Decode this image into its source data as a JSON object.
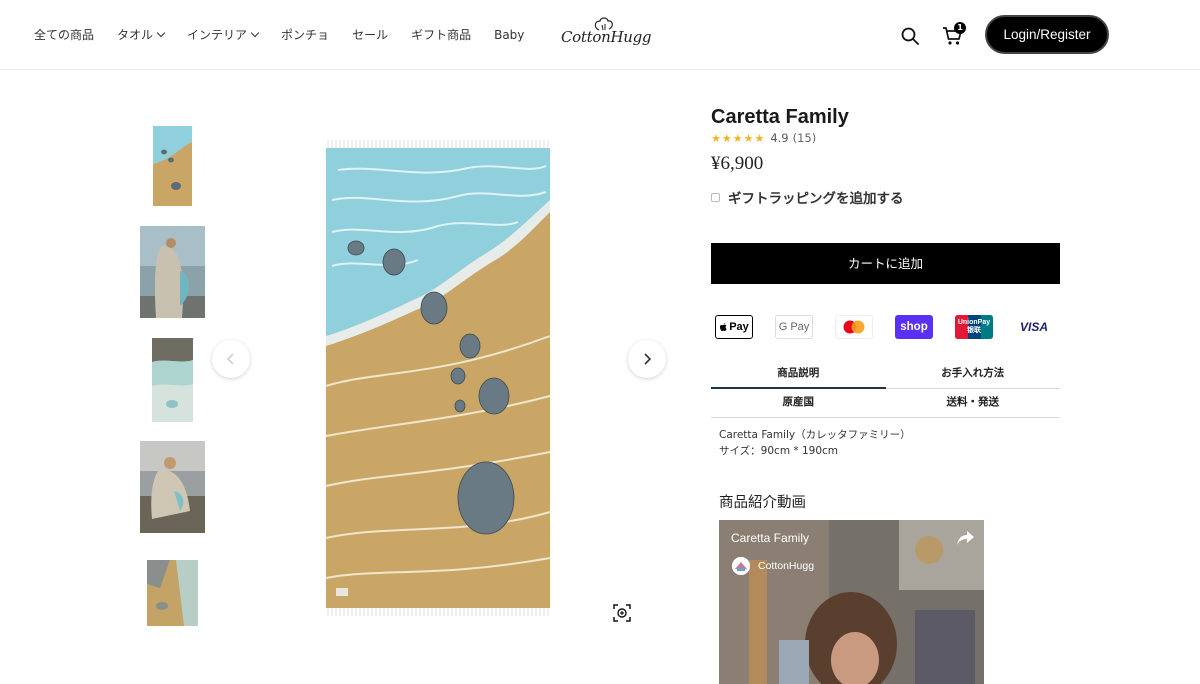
{
  "header": {
    "nav": [
      {
        "label": "全ての商品",
        "dropdown": false
      },
      {
        "label": "タオル",
        "dropdown": true
      },
      {
        "label": "インテリア",
        "dropdown": true
      },
      {
        "label": "ポンチョ",
        "dropdown": false
      },
      {
        "label": "セール",
        "dropdown": false
      },
      {
        "label": "ギフト商品",
        "dropdown": false
      },
      {
        "label": "Baby",
        "dropdown": false
      }
    ],
    "logo_text": "CottonHugg",
    "cart_count": "1",
    "login_label": "Login/Register"
  },
  "product": {
    "title": "Caretta Family",
    "stars": "★★★★★",
    "rating": "4.9",
    "review_count": "(15)",
    "price": "¥6,900",
    "gift_label": "ギフトラッピングを追加する",
    "add_to_cart_label": "カートに追加"
  },
  "payments": {
    "apple": "Pay",
    "google": "G Pay",
    "shop": "shop",
    "union_line1": "UnionPay",
    "union_line2": "银联",
    "visa": "VISA"
  },
  "tabs": [
    [
      "商品説明",
      "お手入れ方法"
    ],
    [
      "原産国",
      "送料・発送"
    ]
  ],
  "description": {
    "line1": "Caretta Family（カレッタファミリー）",
    "line2": "サイズ：90cm * 190cm"
  },
  "video": {
    "section_label": "商品紹介動画",
    "title": "Caretta Family",
    "channel": "CottonHugg"
  },
  "colors": {
    "sea": "#8fd0dc",
    "sand": "#c9a666",
    "accent": "#000000"
  }
}
